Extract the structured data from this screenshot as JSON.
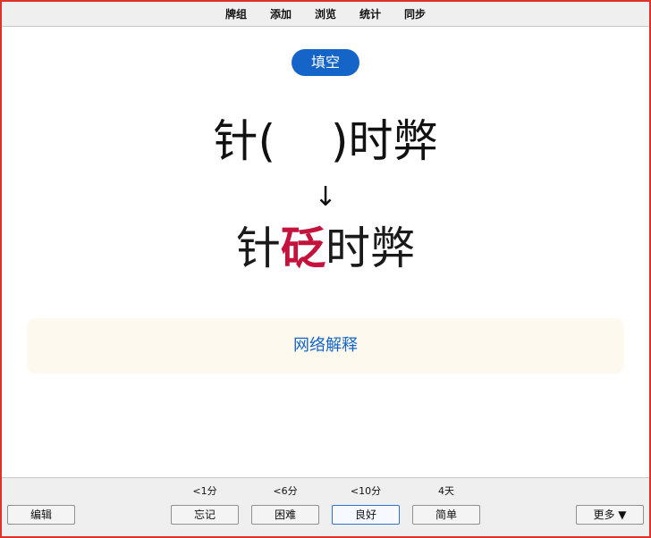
{
  "menubar": {
    "items": [
      "牌组",
      "添加",
      "浏览",
      "统计",
      "同步"
    ]
  },
  "card": {
    "type_label": "填空",
    "question_before": "针(",
    "question_after": ")时弊",
    "arrow": "↓",
    "answer_before": "针",
    "answer_highlight": "砭",
    "answer_after": "时弊",
    "explain_label": "网络解释",
    "colors": {
      "badge": "#1565c8",
      "highlight": "#c4123c",
      "link": "#1565c8",
      "explain_bg": "#fdf9ee"
    }
  },
  "bottombar": {
    "edit_label": "编辑",
    "more_label": "更多 ▼",
    "answers": [
      {
        "interval": "<1分",
        "label": "忘记"
      },
      {
        "interval": "<6分",
        "label": "困难"
      },
      {
        "interval": "<10分",
        "label": "良好"
      },
      {
        "interval": "4天",
        "label": "简单"
      }
    ]
  }
}
